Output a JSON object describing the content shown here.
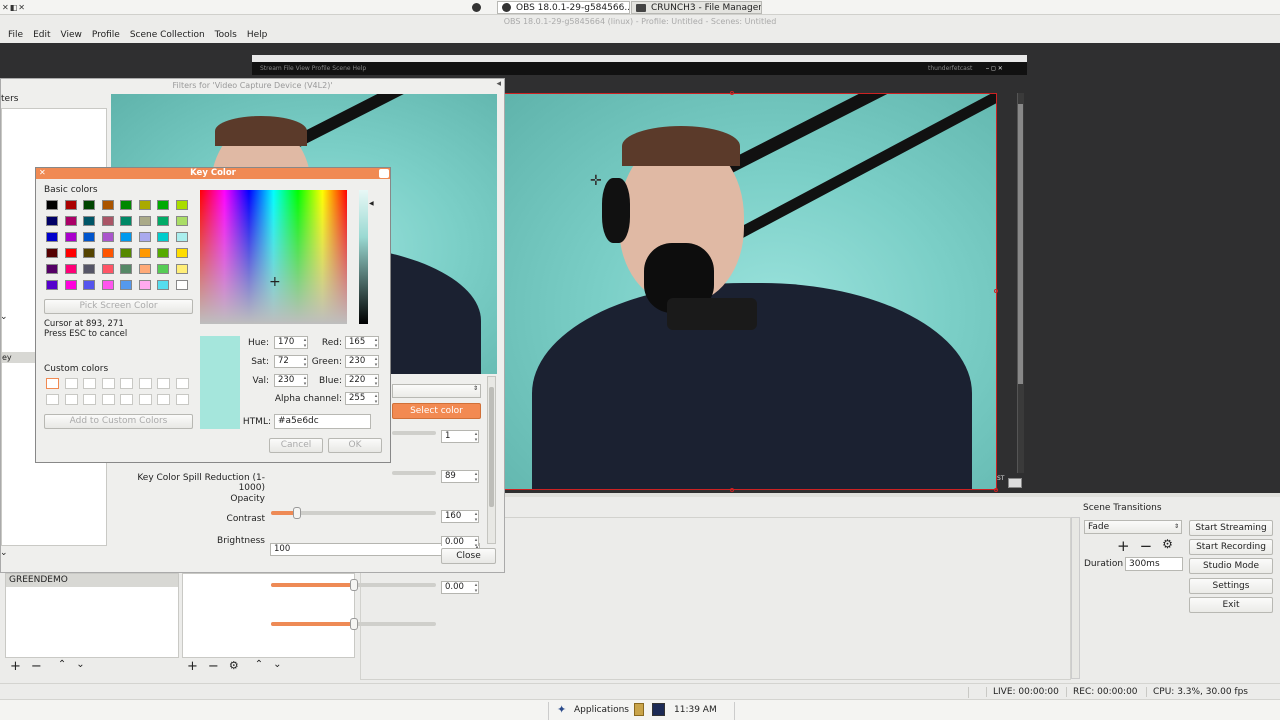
{
  "window_controls": "✕◧✕",
  "topbar": {
    "tasks": [
      {
        "label": "OBS 18.0.1-29-g584566..."
      },
      {
        "label": "CRUNCH3 - File Manager"
      }
    ]
  },
  "window_title": "OBS 18.0.1-29-g5845664 (linux) - Profile: Untitled - Scenes: Untitled",
  "menus": [
    "File",
    "Edit",
    "View",
    "Profile",
    "Scene Collection",
    "Tools",
    "Help"
  ],
  "preview": {
    "inner_menu": "Stream   File   View   Profile   Scene   Help",
    "inner_user": "thunderfetcast",
    "corner_label": "ST"
  },
  "filters_dialog": {
    "title": "Filters for 'Video Capture Device (V4L2)'",
    "left_label": "ters",
    "selected_filter": "ey",
    "color_select_label": "Select color",
    "similarity": "1",
    "smoothness": "89",
    "spill_label": "Key Color Spill Reduction (1-1000)",
    "spill_value": "160",
    "spill_fraction": 0.16,
    "opacity_label": "Opacity",
    "opacity_value": "100",
    "contrast_label": "Contrast",
    "contrast_value": "0.00",
    "contrast_fraction": 0.5,
    "brightness_label": "Brightness",
    "brightness_value": "0.00",
    "brightness_fraction": 0.5,
    "close_label": "Close"
  },
  "key_color_dialog": {
    "title": "Key Color",
    "basic_colors_label": "Basic colors",
    "basic_colors": [
      "#000000",
      "#aa0000",
      "#004400",
      "#aa5500",
      "#008800",
      "#aaaa00",
      "#00aa00",
      "#aadd00",
      "#000066",
      "#aa0066",
      "#005566",
      "#aa5566",
      "#008866",
      "#aaaa88",
      "#00aa66",
      "#aadd66",
      "#0000cc",
      "#aa00cc",
      "#0055cc",
      "#aa55cc",
      "#0099ee",
      "#aaaaee",
      "#00cccc",
      "#aaeeee",
      "#550000",
      "#ff0000",
      "#554400",
      "#ff5500",
      "#558800",
      "#ff9900",
      "#55aa00",
      "#ffdd00",
      "#550066",
      "#ff0077",
      "#555566",
      "#ff5566",
      "#558866",
      "#ffaa77",
      "#55cc55",
      "#ffee77",
      "#5500cc",
      "#ff00dd",
      "#5555ee",
      "#ff55ee",
      "#5599ee",
      "#ffaaee",
      "#55ddee",
      "#ffffff"
    ],
    "pick_screen_label": "Pick Screen Color",
    "cursor_text": "Cursor at 893, 271",
    "esc_text": "Press ESC to cancel",
    "custom_colors_label": "Custom colors",
    "add_custom_label": "Add to Custom Colors",
    "hue_label": "Hue:",
    "hue": "170",
    "sat_label": "Sat:",
    "sat": "72",
    "val_label": "Val:",
    "val": "230",
    "red_label": "Red:",
    "red": "165",
    "green_label": "Green:",
    "green": "230",
    "blue_label": "Blue:",
    "blue": "220",
    "alpha_label": "Alpha channel:",
    "alpha": "255",
    "html_label": "HTML:",
    "html": "#a5e6dc",
    "cancel_label": "Cancel",
    "ok_label": "OK"
  },
  "scenes": {
    "items": [
      "GREENDEMO"
    ]
  },
  "scene_transitions": {
    "title": "Scene Transitions",
    "transition": "Fade",
    "duration_label": "Duration",
    "duration": "300ms"
  },
  "controls": {
    "start_streaming": "Start Streaming",
    "start_recording": "Start Recording",
    "studio_mode": "Studio Mode",
    "settings": "Settings",
    "exit": "Exit"
  },
  "status": {
    "live": "LIVE: 00:00:00",
    "rec": "REC: 00:00:00",
    "cpu": "CPU: 3.3%, 30.00 fps"
  },
  "taskbar": {
    "applications": "Applications",
    "time": "11:39 AM"
  }
}
